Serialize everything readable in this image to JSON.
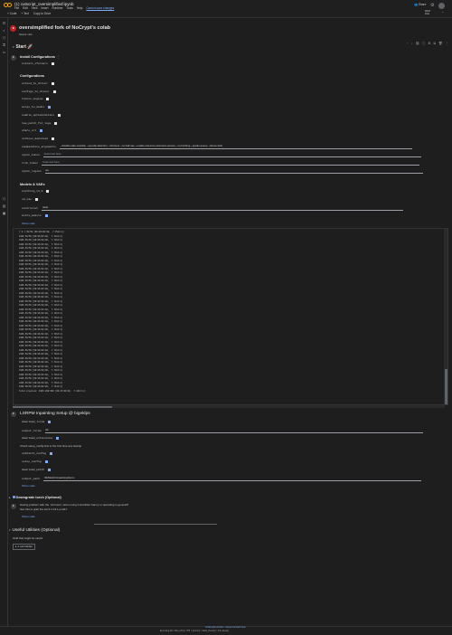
{
  "header": {
    "title": "(1) cutscript_oversimplified.ipynb",
    "menu": [
      "File",
      "Edit",
      "View",
      "Insert",
      "Runtime",
      "Tools",
      "Help"
    ],
    "changes_link": "Cannot save changes",
    "toolbar": [
      "+ Code",
      "+ Text",
      "Copy to Drive"
    ],
    "share": "Share",
    "ram_label": "RAM",
    "disk_label": "Disk"
  },
  "notebook": {
    "title": "oversimplified fork of NoCrypt's colab",
    "source": "Source: Link",
    "start_heading": "Start",
    "install_heading": "Install Configurations",
    "install_fields": [
      {
        "name": "install_xformers",
        "checked": true
      }
    ],
    "config_heading": "Configurations",
    "config_fields": [
      {
        "name": "extend_to_driver",
        "checked": true
      },
      {
        "name": "configs_to_driver",
        "checked": true
      },
      {
        "name": "tunnel_engine",
        "checked": true
      },
      {
        "name": "merge_to_model",
        "checked": false
      },
      {
        "name": "enable_optimizations",
        "checked": true
      },
      {
        "name": "low_patch_for_logs",
        "checked": true
      },
      {
        "name": "share_url",
        "checked": false
      },
      {
        "name": "verbose_download",
        "checked": true
      }
    ],
    "commandline_label": "commandline_arguments",
    "commandline_value": "--disable-safe-unpickle --opt-sdp-attention --xformers --no-half-vae --enable-insecure-extension-access --no-hashing --gradio-queue --theme dark",
    "ngrok_label": "ngrok_token",
    "ngrok_placeholder": "Insert text here",
    "ngrok_region_label": "ngrok_region",
    "ngrok_region_value": "us",
    "zrok_label": "zrok_token",
    "zrok_placeholder": "Insert text here",
    "models_heading": "Models & VAEs",
    "models_fields": [
      {
        "name": "anything_v4_0",
        "checked": true
      },
      {
        "name": "sd_vae",
        "checked": true
      }
    ],
    "controlnet_label": "controlnet",
    "controlnet_value": "none",
    "multi_models_label": "multi_models",
    "show_code": "Show code",
    "output_lines": [
      "[ 0 ] 50/50 [00:00<00:00,  7.79it/s]",
      "100% 50/50 [00:06<00:00,  7.78it/s]",
      "100% 50/50 [00:06<00:00,  7.78it/s]",
      "100% 50/50 [00:06<00:00,  7.79it/s]",
      "100% 50/50 [00:06<00:00,  7.79it/s]",
      "100% 50/50 [00:06<00:00,  7.79it/s]",
      "100% 50/50 [00:06<00:00,  7.79it/s]",
      "100% 50/50 [00:06<00:00,  7.78it/s]",
      "100% 50/50 [00:06<00:00,  7.79it/s]",
      "100% 50/50 [00:06<00:00,  7.78it/s]",
      "100% 50/50 [00:06<00:00,  7.79it/s]",
      "100% 50/50 [00:06<00:00,  7.79it/s]",
      "100% 50/50 [00:06<00:00,  7.79it/s]",
      "100% 50/50 [00:06<00:00,  7.78it/s]",
      "100% 50/50 [00:06<00:00,  7.79it/s]",
      "100% 50/50 [00:06<00:00,  7.79it/s]",
      "100% 50/50 [00:06<00:00,  7.79it/s]",
      "100% 50/50 [00:06<00:00,  7.79it/s]",
      "100% 50/50 [00:06<00:00,  7.79it/s]",
      "100% 50/50 [00:06<00:00,  7.78it/s]",
      "100% 50/50 [00:06<00:00,  7.79it/s]",
      "100% 50/50 [00:06<00:00,  7.79it/s]",
      "100% 50/50 [00:06<00:00,  7.79it/s]",
      "100% 50/50 [00:06<00:00,  7.78it/s]",
      "100% 50/50 [00:06<00:00,  7.79it/s]",
      "100% 50/50 [00:06<00:00,  7.79it/s]",
      "100% 50/50 [00:06<00:00,  7.79it/s]",
      "100% 50/50 [00:06<00:00,  7.79it/s]",
      "100% 50/50 [00:06<00:00,  7.78it/s]",
      "100% 50/50 [00:06<00:00,  7.79it/s]",
      "100% 50/50 [00:06<00:00,  7.79it/s]",
      "100% 50/50 [00:06<00:00,  7.79it/s]",
      "100% 50/50 [00:06<00:00,  7.78it/s]",
      "100% 50/50 [00:06<00:00,  7.79it/s]",
      "100% 50/50 [00:06<00:00,  7.79it/s]",
      "100% 50/50 [00:06<00:00,  7.79it/s]",
      "100% 50/50 [00:06<00:00,  7.79it/s]",
      "100% 50/50 [00:06<00:00,  7.79it/s]",
      "100% 50/50 [00:06<00:00,  7.78it/s]",
      "Total progress: 100% 200/200 [00:27<00:00,  7.44it/s]"
    ],
    "lsrpm_heading": "LSRPM Inpainting Setup @ bigeklps",
    "lsrpm_fields_a": [
      {
        "name": "download_lsrpm",
        "checked": false,
        "type": "check"
      },
      {
        "name": "output_lsrpm",
        "value": "lsr",
        "type": "select"
      },
      {
        "name": "download_extensions",
        "checked": true,
        "type": "check"
      }
    ],
    "lsrpm_note": "Check setup_config first to the first time any startup",
    "lsrpm_fields_b": [
      {
        "name": "setbatch_config",
        "checked": true
      },
      {
        "name": "setup_config",
        "checked": true
      },
      {
        "name": "download_patch",
        "checked": true
      }
    ],
    "output_path_label": "output_path",
    "output_path_value": "/SDWebUI/inpainting/lsrpm",
    "inpaint_heading": "Downgrade torch (Optional)",
    "inpaint_text_1": "Having problem with the `xformers` when using ControlNet Canny or upscaling in general?",
    "inpaint_text_2": "See this to grab the torch 1.13.1+cu117",
    "useful_heading": "Useful Utilities (Optional)",
    "useful_note": "Stuff that might be useful",
    "cells_hidden": "1 cell hidden",
    "show_code_2": "Show code",
    "show_code_3": "Show code"
  },
  "status": {
    "links": "Colab paid products  -  Cancel contracts here",
    "text": "Executing (8m 43s)  cell line: 879  >  launch()  >  block_thread()  >  time.sleep()"
  }
}
